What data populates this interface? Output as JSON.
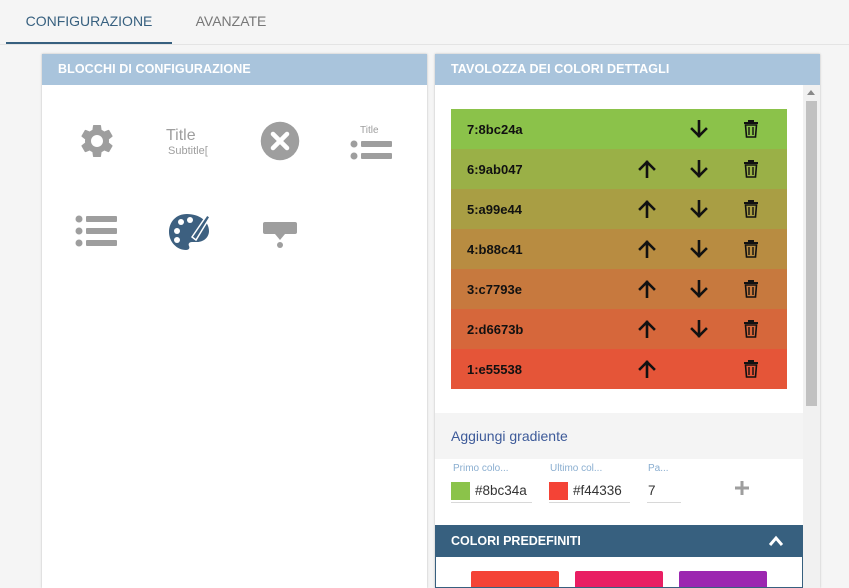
{
  "tabs": [
    {
      "label": "CONFIGURAZIONE",
      "active": true
    },
    {
      "label": "AVANZATE",
      "active": false
    }
  ],
  "left_panel": {
    "title": "BLOCCHI DI CONFIGURAZIONE",
    "blocks": [
      {
        "icon": "gear-icon"
      },
      {
        "icon": "title-subtitle-icon",
        "title_text": "Title",
        "subtitle_text": "Subtitle["
      },
      {
        "icon": "close-circle-icon"
      },
      {
        "icon": "title-list-icon",
        "title_text": "Title"
      },
      {
        "icon": "list-icon"
      },
      {
        "icon": "palette-icon"
      },
      {
        "icon": "tooltip-icon"
      }
    ]
  },
  "right_panel": {
    "title": "TAVOLOZZA DEI COLORI DETTAGLI",
    "palette": [
      {
        "label": "7:8bc24a",
        "color": "#8bc24a",
        "up": false,
        "down": true
      },
      {
        "label": "6:9ab047",
        "color": "#9ab047",
        "up": true,
        "down": true
      },
      {
        "label": "5:a99e44",
        "color": "#a99e44",
        "up": true,
        "down": true
      },
      {
        "label": "4:b88c41",
        "color": "#b88c41",
        "up": true,
        "down": true
      },
      {
        "label": "3:c7793e",
        "color": "#c7793e",
        "up": true,
        "down": true
      },
      {
        "label": "2:d6673b",
        "color": "#d6673b",
        "up": true,
        "down": true
      },
      {
        "label": "1:e55538",
        "color": "#e55538",
        "up": true,
        "down": false
      }
    ],
    "gradient_link": "Aggiungi gradiente",
    "gradient_form": {
      "first_color_label": "Primo colo...",
      "first_color_value": "#8bc34a",
      "first_color_swatch": "#8bc34a",
      "last_color_label": "Ultimo col...",
      "last_color_value": "#f44336",
      "last_color_swatch": "#f44336",
      "steps_label": "Pa...",
      "steps_value": "7"
    },
    "predefined_title": "COLORI PREDEFINITI",
    "predefined_swatches": [
      "#f44336",
      "#e91e63",
      "#9c27b0"
    ]
  },
  "colors": {
    "accent": "#37607f",
    "header_light": "#a9c4dc",
    "icon_gray": "#9e9e9e",
    "palette_icon": "#3d6080",
    "link": "#3d5a99"
  }
}
